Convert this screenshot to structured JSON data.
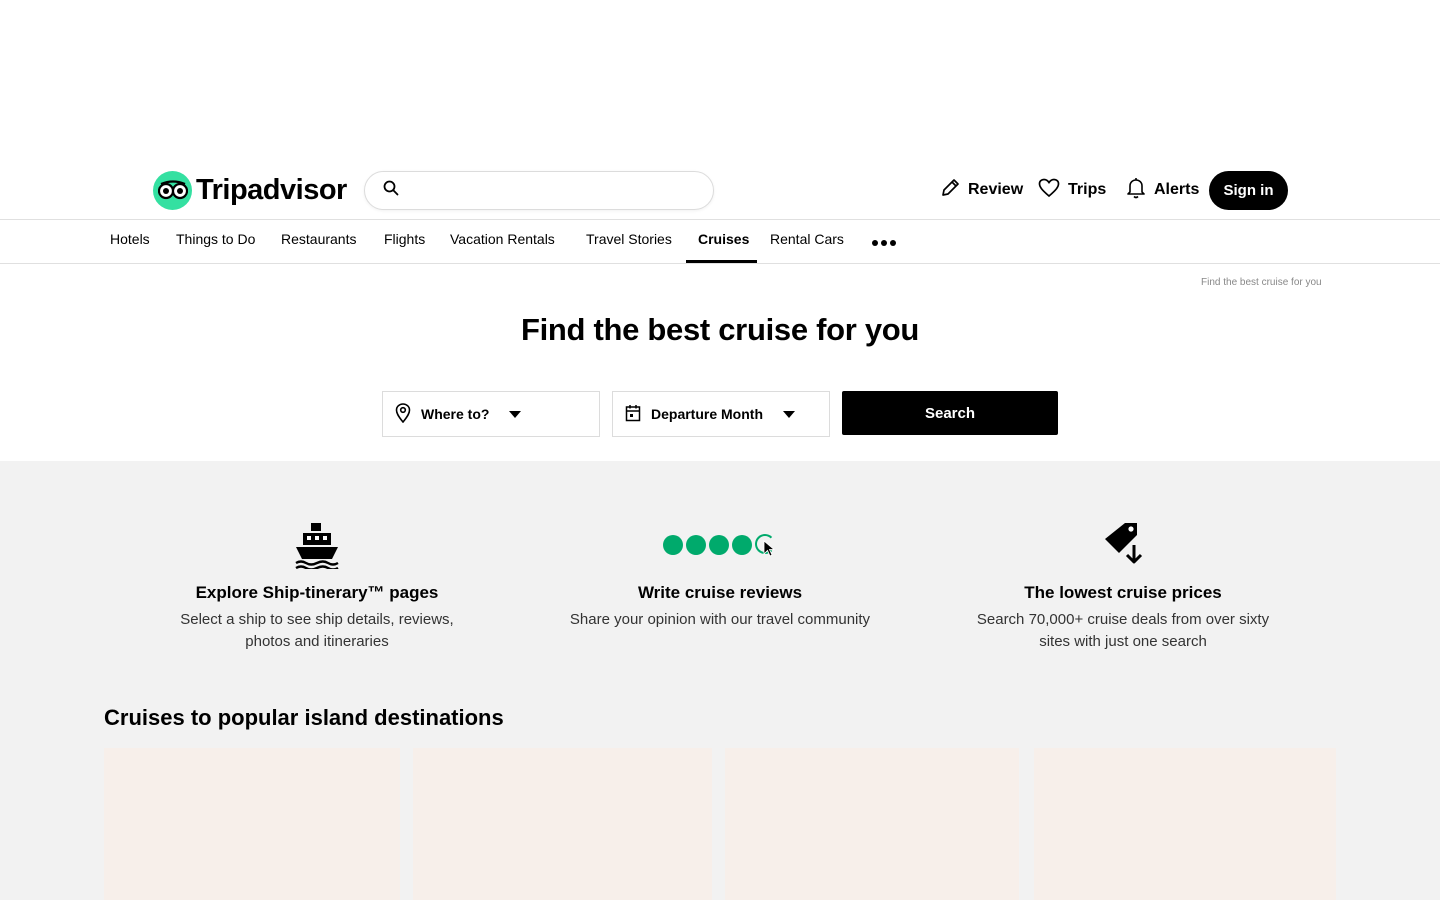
{
  "header": {
    "logo_text": "Tripadvisor",
    "search_placeholder": "",
    "review_label": "Review",
    "trips_label": "Trips",
    "alerts_label": "Alerts",
    "signin_label": "Sign in"
  },
  "nav": {
    "items": [
      {
        "label": "Hotels"
      },
      {
        "label": "Things to Do"
      },
      {
        "label": "Restaurants"
      },
      {
        "label": "Flights"
      },
      {
        "label": "Vacation Rentals"
      },
      {
        "label": "Travel Stories"
      },
      {
        "label": "Cruises",
        "active": true
      },
      {
        "label": "Rental Cars"
      }
    ]
  },
  "page": {
    "tiny_title": "Find the best cruise for you",
    "hero_title": "Find the best cruise for you"
  },
  "search_form": {
    "where_label": "Where to?",
    "month_label": "Departure Month",
    "search_label": "Search"
  },
  "features": [
    {
      "icon": "ship-icon",
      "title": "Explore Ship-tinerary™ pages",
      "desc_line1": "Select a ship to see ship details, reviews,",
      "desc_line2": "photos and itineraries"
    },
    {
      "icon": "rating-bubbles-icon",
      "title": "Write cruise reviews",
      "desc_line1": "Share your opinion with our travel community",
      "desc_line2": ""
    },
    {
      "icon": "price-tag-down-icon",
      "title": "The lowest cruise prices",
      "desc_line1": "Search 70,000+ cruise deals from over sixty",
      "desc_line2": "sites with just one search"
    }
  ],
  "section": {
    "title": "Cruises to popular island destinations"
  },
  "colors": {
    "brand_green": "#34e0a1",
    "bubble_green": "#00aa6c",
    "feature_bg": "#f2f2f2",
    "card_bg": "#f7efea"
  }
}
